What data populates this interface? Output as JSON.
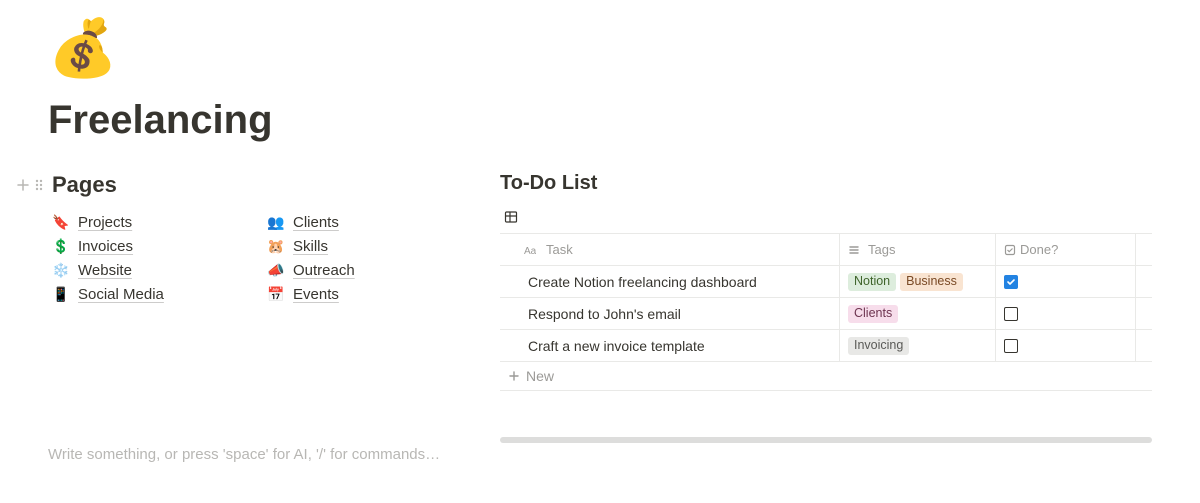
{
  "header": {
    "icon": "💰",
    "title": "Freelancing"
  },
  "pages_section": {
    "title": "Pages",
    "links": [
      {
        "icon": "🔖",
        "label": "Projects"
      },
      {
        "icon": "👥",
        "label": "Clients"
      },
      {
        "icon": "💲",
        "label": "Invoices"
      },
      {
        "icon": "🐹",
        "label": "Skills"
      },
      {
        "icon": "❄️",
        "label": "Website"
      },
      {
        "icon": "📣",
        "label": "Outreach"
      },
      {
        "icon": "📱",
        "label": "Social Media"
      },
      {
        "icon": "📅",
        "label": "Events"
      }
    ]
  },
  "todo": {
    "title": "To-Do List",
    "columns": {
      "task": "Task",
      "tags": "Tags",
      "done": "Done?"
    },
    "rows": [
      {
        "task": "Create Notion freelancing dashboard",
        "tags": [
          {
            "text": "Notion",
            "color": "green"
          },
          {
            "text": "Business",
            "color": "orange"
          }
        ],
        "done": true
      },
      {
        "task": "Respond to John's email",
        "tags": [
          {
            "text": "Clients",
            "color": "pink"
          }
        ],
        "done": false
      },
      {
        "task": "Craft a new invoice template",
        "tags": [
          {
            "text": "Invoicing",
            "color": "gray"
          }
        ],
        "done": false
      }
    ],
    "new_label": "New"
  },
  "prompt": "Write something, or press 'space' for AI, '/' for commands…"
}
